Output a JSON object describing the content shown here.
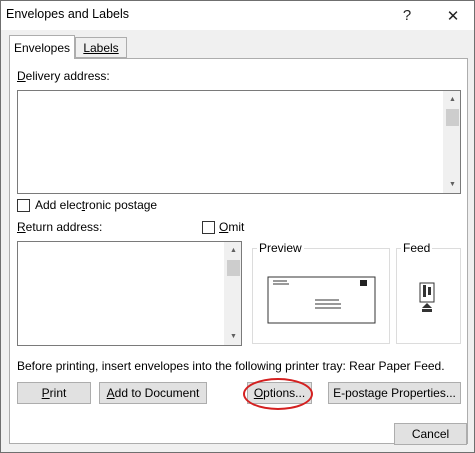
{
  "window": {
    "title": "Envelopes and Labels",
    "help_glyph": "?",
    "close_glyph": "✕"
  },
  "tabs": [
    {
      "label": "Envelopes",
      "selected": true
    },
    {
      "label": "Labels",
      "selected": false
    }
  ],
  "delivery": {
    "label_key": "D",
    "label_rest": "elivery address:",
    "value": ""
  },
  "postage": {
    "label_pre": "Add elec",
    "label_key": "t",
    "label_post": "ronic postage",
    "checked": false
  },
  "return": {
    "label_key": "R",
    "label_rest": "eturn address:",
    "value": "",
    "omit_key": "O",
    "omit_rest": "mit",
    "omit_checked": false
  },
  "preview": {
    "title": "Preview"
  },
  "feed": {
    "title": "Feed"
  },
  "info_text": "Before printing, insert envelopes into the following printer tray: Rear Paper Feed.",
  "buttons": {
    "print_key": "P",
    "print_rest": "rint",
    "add_key": "A",
    "add_rest": "dd to Document",
    "options_key": "O",
    "options_rest": "ptions...",
    "epostage": "E-postage Properties...",
    "cancel": "Cancel"
  },
  "colors": {
    "highlight_ring": "#d42020"
  }
}
